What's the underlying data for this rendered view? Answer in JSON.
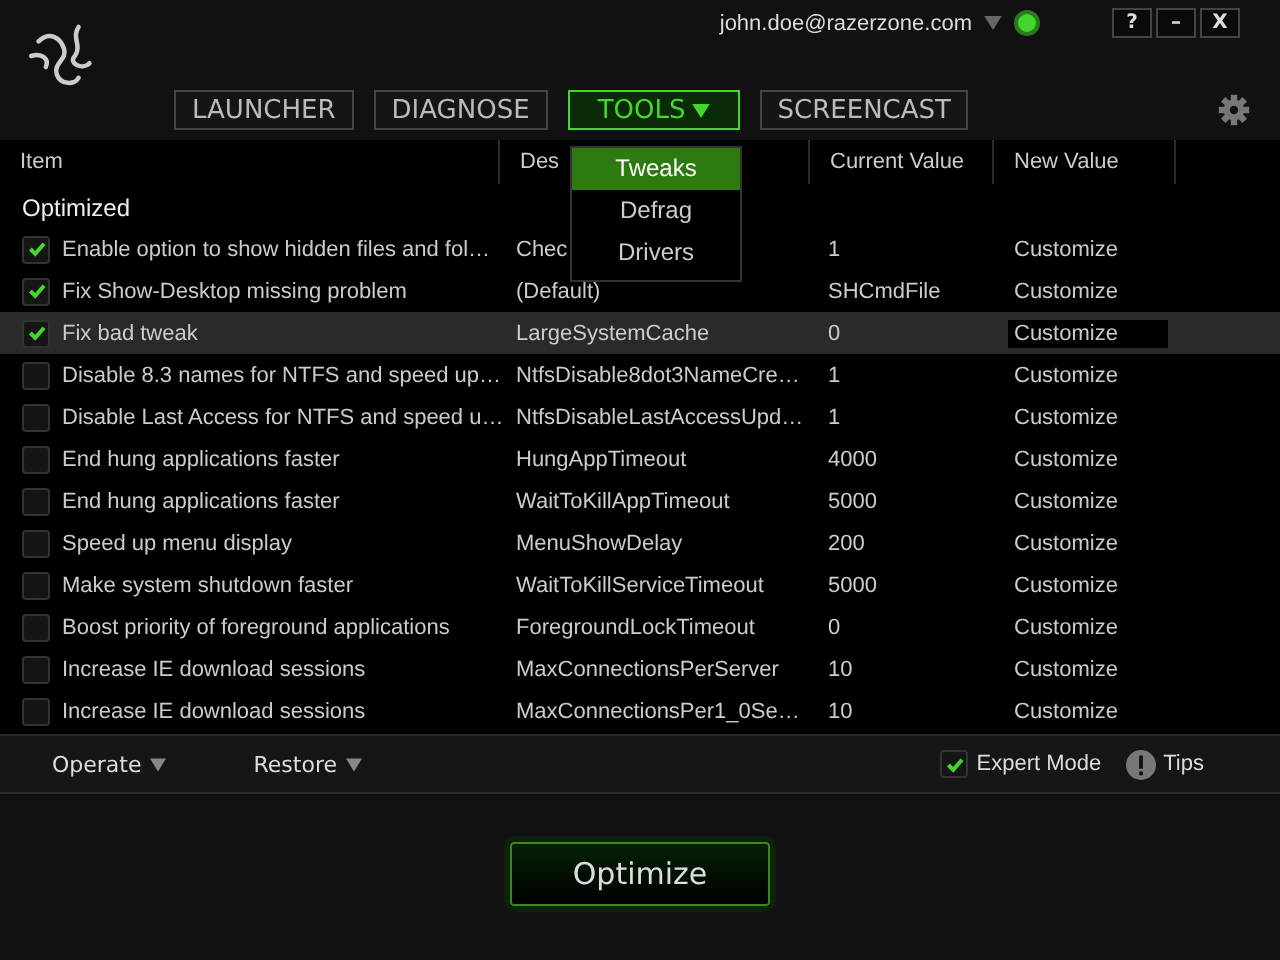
{
  "account": {
    "email": "john.doe@razerzone.com",
    "online": true
  },
  "window_buttons": [
    "?",
    "–",
    "X"
  ],
  "tabs": [
    {
      "label": "LAUNCHER",
      "selected": false
    },
    {
      "label": "DIAGNOSE",
      "selected": false
    },
    {
      "label": "TOOLS",
      "selected": true
    },
    {
      "label": "SCREENCAST",
      "selected": false
    }
  ],
  "dropdown": [
    {
      "label": "Tweaks",
      "selected": true
    },
    {
      "label": "Defrag",
      "selected": false
    },
    {
      "label": "Drivers",
      "selected": false
    }
  ],
  "table": {
    "columns": [
      "Item",
      "Des",
      "Current Value",
      "New Value"
    ],
    "group": "Optimized",
    "rows": [
      {
        "item": "Enable option to show hidden files and fol…",
        "desc": "Chec",
        "current": "1",
        "new": "Customize",
        "checked": true,
        "selected": false
      },
      {
        "item": "Fix Show-Desktop missing problem",
        "desc": "(Default)",
        "current": "SHCmdFile",
        "new": "Customize",
        "checked": true,
        "selected": false
      },
      {
        "item": "Fix bad tweak",
        "desc": "LargeSystemCache",
        "current": "0",
        "new": "Customize",
        "checked": true,
        "selected": true
      },
      {
        "item": "Disable 8.3 names for NTFS and speed up…",
        "desc": "NtfsDisable8dot3NameCre…",
        "current": "1",
        "new": "Customize",
        "checked": false,
        "selected": false
      },
      {
        "item": "Disable Last Access for NTFS and speed u…",
        "desc": "NtfsDisableLastAccessUpd…",
        "current": "1",
        "new": "Customize",
        "checked": false,
        "selected": false
      },
      {
        "item": "End hung applications faster",
        "desc": "HungAppTimeout",
        "current": "4000",
        "new": "Customize",
        "checked": false,
        "selected": false
      },
      {
        "item": "End hung applications faster",
        "desc": "WaitToKillAppTimeout",
        "current": "5000",
        "new": "Customize",
        "checked": false,
        "selected": false
      },
      {
        "item": "Speed up menu display",
        "desc": "MenuShowDelay",
        "current": "200",
        "new": "Customize",
        "checked": false,
        "selected": false
      },
      {
        "item": "Make system shutdown faster",
        "desc": "WaitToKillServiceTimeout",
        "current": "5000",
        "new": "Customize",
        "checked": false,
        "selected": false
      },
      {
        "item": "Boost priority of foreground applications",
        "desc": "ForegroundLockTimeout",
        "current": "0",
        "new": "Customize",
        "checked": false,
        "selected": false
      },
      {
        "item": "Increase IE download sessions",
        "desc": "MaxConnectionsPerServer",
        "current": "10",
        "new": "Customize",
        "checked": false,
        "selected": false
      },
      {
        "item": "Increase IE download sessions",
        "desc": "MaxConnectionsPer1_0Se…",
        "current": "10",
        "new": "Customize",
        "checked": false,
        "selected": false
      }
    ]
  },
  "toolbar": {
    "operate": "Operate",
    "restore": "Restore",
    "expert_mode": {
      "label": "Expert Mode",
      "checked": true
    },
    "tips": "Tips"
  },
  "optimize_button": "Optimize"
}
